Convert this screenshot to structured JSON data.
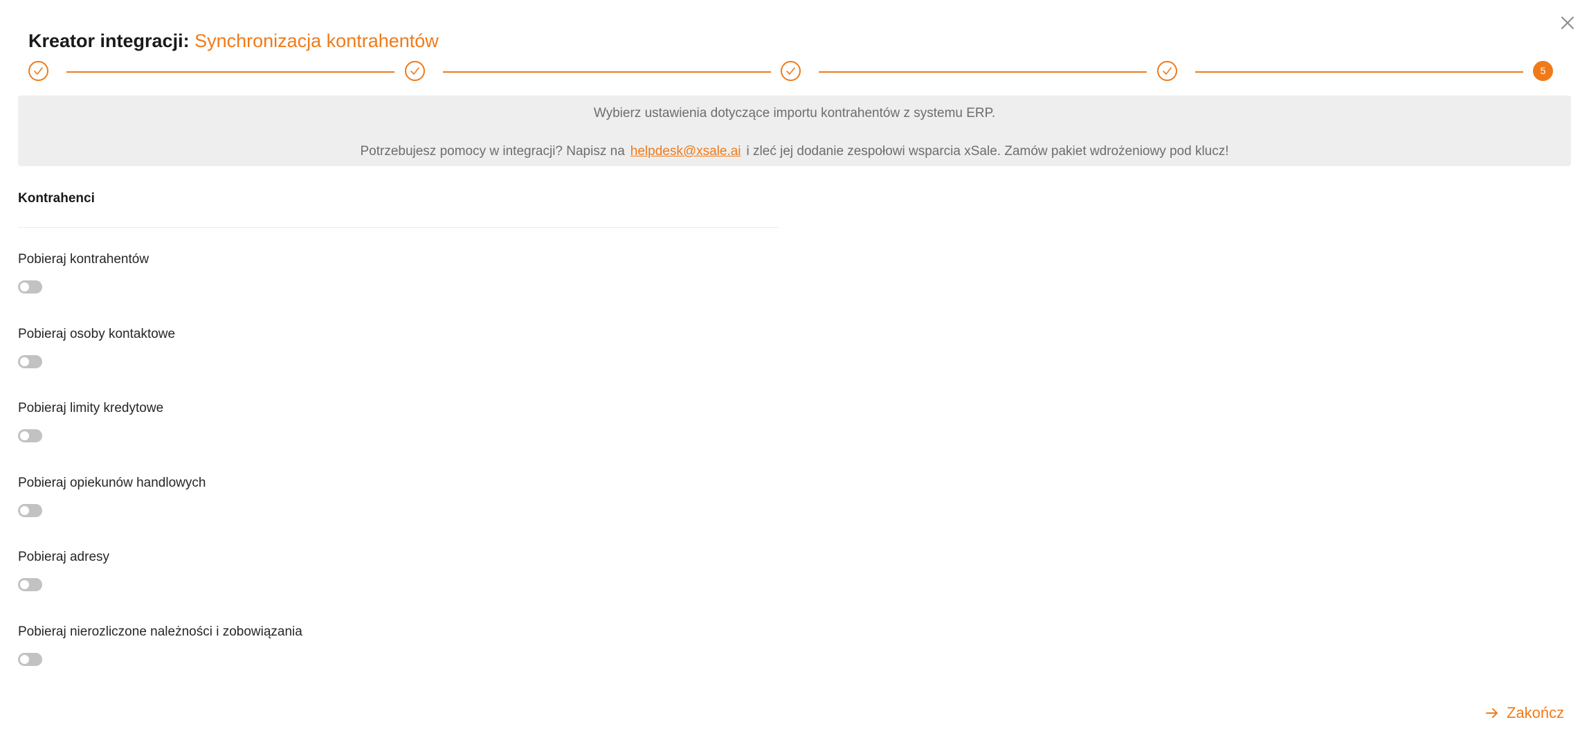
{
  "header": {
    "title_prefix": "Kreator integracji:",
    "title_highlight": "Synchronizacja kontrahentów"
  },
  "stepper": {
    "current_step_label": "5"
  },
  "info": {
    "line1": "Wybierz ustawienia dotyczące importu kontrahentów z systemu ERP.",
    "line2_before": "Potrzebujesz pomocy w integracji? Napisz na",
    "link_text": "helpdesk@xsale.ai",
    "line2_after": "i zleć jej dodanie zespołowi wsparcia xSale. Zamów pakiet wdrożeniowy pod klucz!"
  },
  "section": {
    "title": "Kontrahenci"
  },
  "settings": [
    {
      "label": "Pobieraj kontrahentów",
      "enabled": false
    },
    {
      "label": "Pobieraj osoby kontaktowe",
      "enabled": false
    },
    {
      "label": "Pobieraj limity kredytowe",
      "enabled": false
    },
    {
      "label": "Pobieraj opiekunów handlowych",
      "enabled": false
    },
    {
      "label": "Pobieraj adresy",
      "enabled": false
    },
    {
      "label": "Pobieraj nierozliczone należności i zobowiązania",
      "enabled": false
    }
  ],
  "footer": {
    "finish_label": "Zakończ"
  },
  "icons": {
    "close": "close-icon",
    "step_done": "check-icon",
    "finish": "arrow-right-icon"
  },
  "colors": {
    "accent": "#f07a1a",
    "info_background": "#eeeeee",
    "toggle_off": "#c2c2c2"
  }
}
